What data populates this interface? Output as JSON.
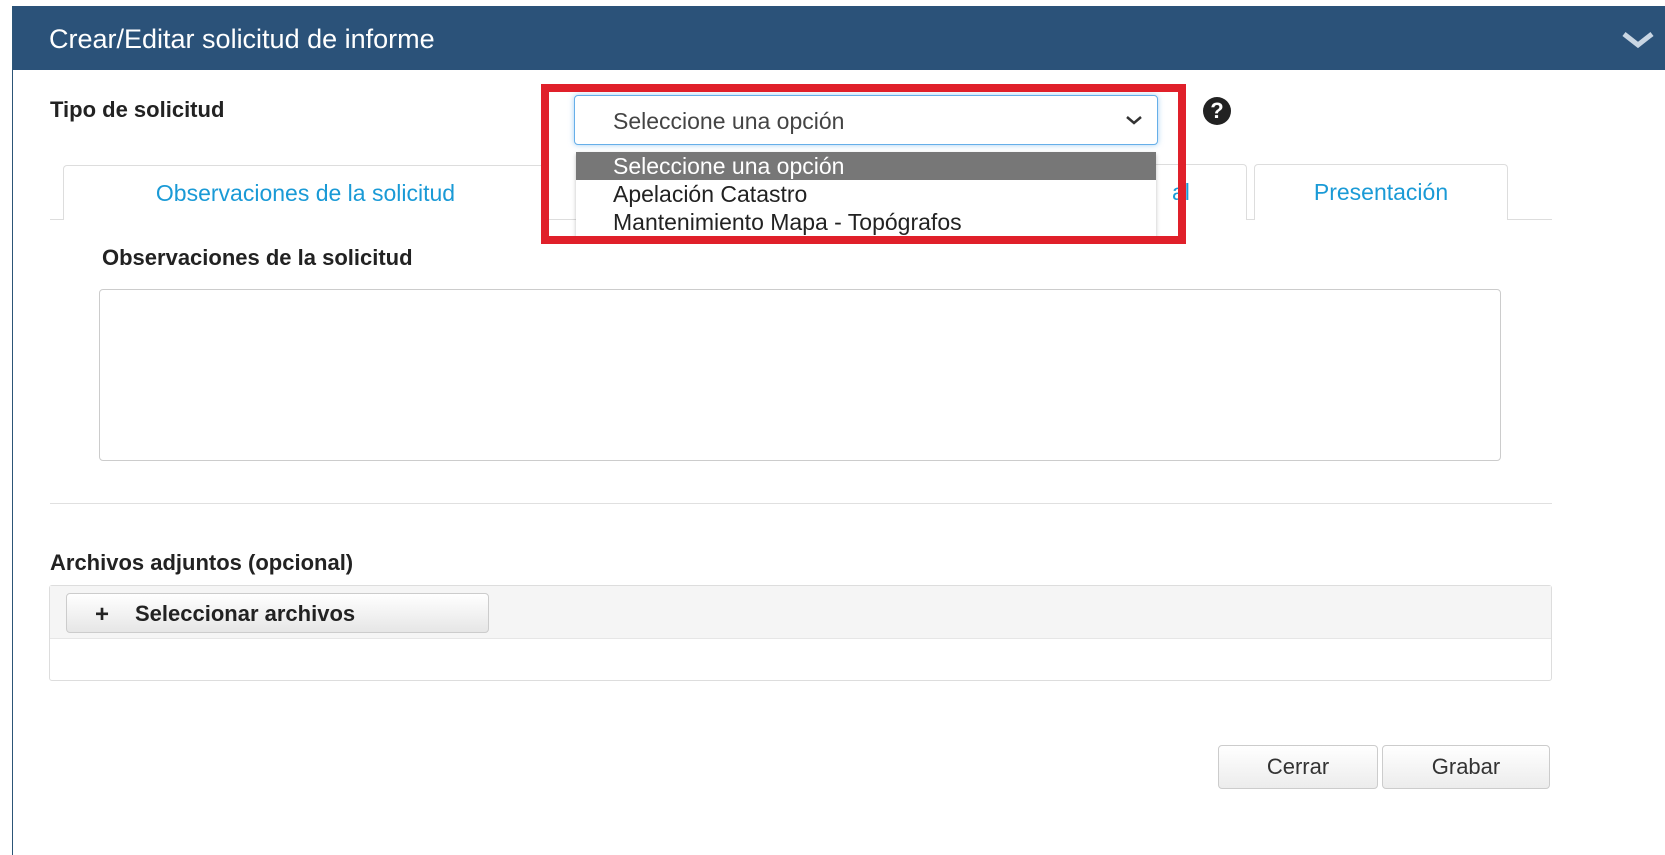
{
  "panel": {
    "title": "Crear/Editar solicitud de informe"
  },
  "form": {
    "tipo_label": "Tipo de solicitud",
    "tipo_selected": "Seleccione una opción",
    "help_glyph": "?",
    "options": [
      "Seleccione una opción",
      "Apelación Catastro",
      "Mantenimiento Mapa - Topógrafos"
    ]
  },
  "tabs": {
    "observaciones": "Observaciones de la solicitud",
    "partial_hidden": "al",
    "presentacion": "Presentación"
  },
  "observaciones": {
    "heading": "Observaciones de la solicitud"
  },
  "adjuntos": {
    "label": "Archivos adjuntos (opcional)",
    "button_label": "Seleccionar archivos",
    "button_icon": "+"
  },
  "footer": {
    "cerrar": "Cerrar",
    "grabar": "Grabar"
  },
  "colors": {
    "header": "#2b5279",
    "link": "#1a9ad6",
    "highlight": "#e0202a",
    "selected_option": "#777777"
  }
}
